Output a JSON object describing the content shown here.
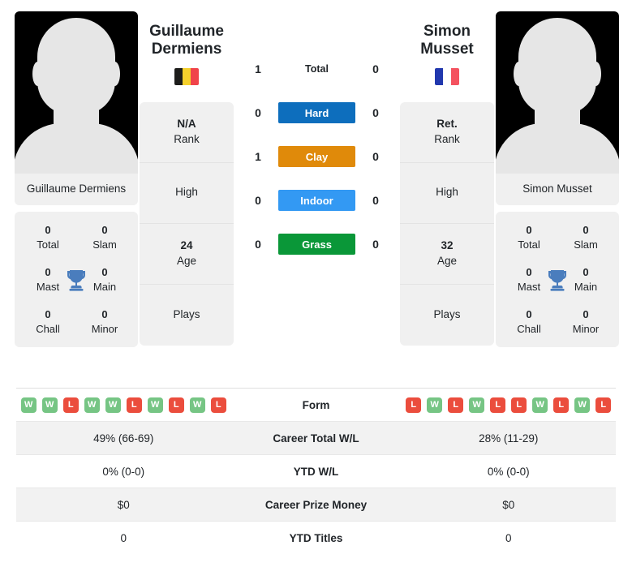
{
  "colors": {
    "hard": "#0d6ebd",
    "clay": "#e08a0a",
    "indoor": "#3399f3",
    "grass": "#0a9738",
    "win": "#76c584",
    "loss": "#eb4d3d",
    "trophy": "#4a7dbd",
    "card_bg": "#f0f0f0"
  },
  "players": {
    "left": {
      "first_name": "Guillaume",
      "last_name": "Dermiens",
      "full_name": "Guillaume Dermiens",
      "flag": "belgium",
      "flag_colors": [
        "#1d1d1b",
        "#f4d02c",
        "#f0434a"
      ],
      "rank_value": "N/A",
      "rank_label": "Rank",
      "high_value": "",
      "high_label": "High",
      "age_value": "24",
      "age_label": "Age",
      "plays_value": "",
      "plays_label": "Plays",
      "titles": [
        {
          "value": "0",
          "label": "Total"
        },
        {
          "value": "0",
          "label": "Slam"
        },
        {
          "value": "0",
          "label": "Mast"
        },
        {
          "value": "0",
          "label": "Main"
        },
        {
          "value": "0",
          "label": "Chall"
        },
        {
          "value": "0",
          "label": "Minor"
        }
      ],
      "form": [
        "W",
        "W",
        "L",
        "W",
        "W",
        "L",
        "W",
        "L",
        "W",
        "L"
      ],
      "career_wl": "49% (66-69)",
      "ytd_wl": "0% (0-0)",
      "career_prize_money": "$0",
      "ytd_titles": "0"
    },
    "right": {
      "first_name": "Simon",
      "last_name": "Musset",
      "full_name": "Simon Musset",
      "flag": "france",
      "flag_colors": [
        "#2138ae",
        "#ffffff",
        "#f4525f"
      ],
      "rank_value": "Ret.",
      "rank_label": "Rank",
      "high_value": "",
      "high_label": "High",
      "age_value": "32",
      "age_label": "Age",
      "plays_value": "",
      "plays_label": "Plays",
      "titles": [
        {
          "value": "0",
          "label": "Total"
        },
        {
          "value": "0",
          "label": "Slam"
        },
        {
          "value": "0",
          "label": "Mast"
        },
        {
          "value": "0",
          "label": "Main"
        },
        {
          "value": "0",
          "label": "Chall"
        },
        {
          "value": "0",
          "label": "Minor"
        }
      ],
      "form": [
        "L",
        "W",
        "L",
        "W",
        "L",
        "L",
        "W",
        "L",
        "W",
        "L"
      ],
      "career_wl": "28% (11-29)",
      "ytd_wl": "0% (0-0)",
      "career_prize_money": "$0",
      "ytd_titles": "0"
    }
  },
  "head_to_head": [
    {
      "label": "Total",
      "left": "1",
      "right": "0",
      "style": "plain",
      "color": ""
    },
    {
      "label": "Hard",
      "left": "0",
      "right": "0",
      "style": "badge",
      "color": "#0d6ebd"
    },
    {
      "label": "Clay",
      "left": "1",
      "right": "0",
      "style": "badge",
      "color": "#e08a0a"
    },
    {
      "label": "Indoor",
      "left": "0",
      "right": "0",
      "style": "badge",
      "color": "#3399f3"
    },
    {
      "label": "Grass",
      "left": "0",
      "right": "0",
      "style": "badge",
      "color": "#0a9738"
    }
  ],
  "table": {
    "rows": [
      {
        "label": "Form",
        "type": "form"
      },
      {
        "label": "Career Total W/L",
        "type": "text",
        "key": "career_wl"
      },
      {
        "label": "YTD W/L",
        "type": "text",
        "key": "ytd_wl"
      },
      {
        "label": "Career Prize Money",
        "type": "text",
        "key": "career_prize_money"
      },
      {
        "label": "YTD Titles",
        "type": "text",
        "key": "ytd_titles"
      }
    ]
  }
}
